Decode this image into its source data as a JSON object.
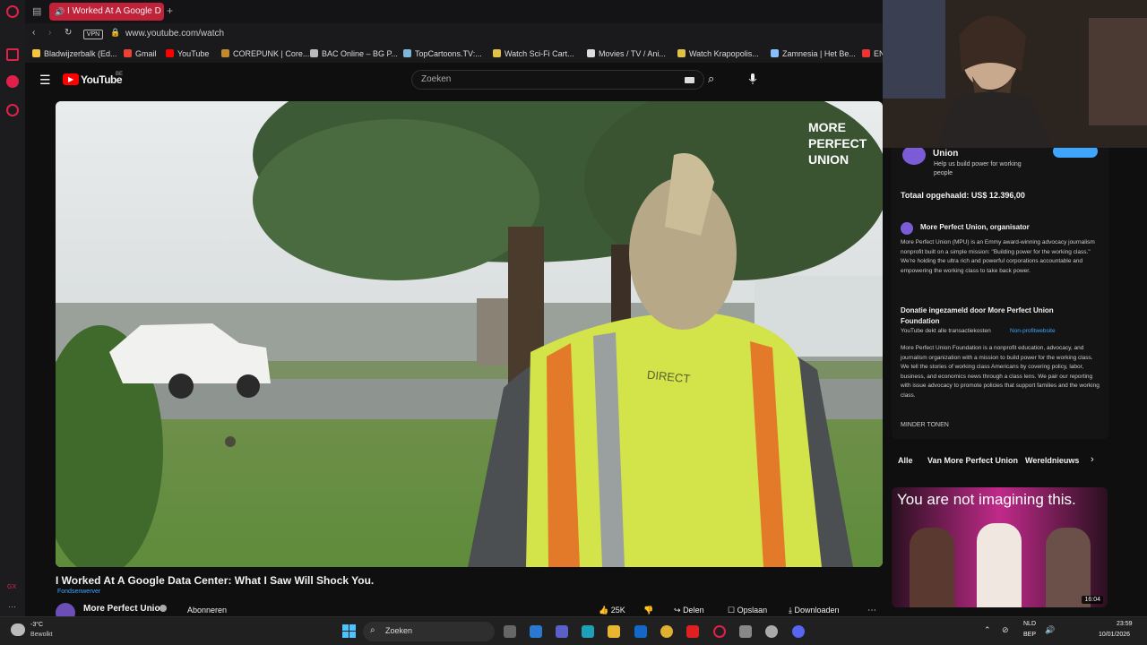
{
  "browser": {
    "active_tab_title": "I Worked At A Google D",
    "url": "www.youtube.com/watch",
    "vpn_label": "VPN",
    "bookmarks": [
      {
        "label": "Bladwijzerbalk (Ed...",
        "color": "#f5c542"
      },
      {
        "label": "Gmail",
        "color": "#ea4335"
      },
      {
        "label": "YouTube",
        "color": "#ff0000"
      },
      {
        "label": "COREPUNK | Core...",
        "color": "#c28a2e"
      },
      {
        "label": "BAC Online – BG P...",
        "color": "#bbbbbb"
      },
      {
        "label": "TopCartoons.TV:...",
        "color": "#7fb7d9"
      },
      {
        "label": "Watch Sci-Fi Cart...",
        "color": "#e0c14a"
      },
      {
        "label": "Movies / TV / Ani...",
        "color": "#dddddd"
      },
      {
        "label": "Watch Krapopolis...",
        "color": "#e0c14a"
      },
      {
        "label": "Zamnesia | Het Be...",
        "color": "#88c0ff"
      },
      {
        "label": "EN",
        "color": "#e33"
      }
    ]
  },
  "youtube": {
    "logo_text": "YouTube",
    "region": "BE",
    "search_placeholder": "Zoeken",
    "video_watermark": [
      "MORE",
      "PERFECT",
      "UNION"
    ],
    "vest_text": "DIRECT",
    "video_title": "I Worked At A Google Data Center: What I Saw Will Shock You.",
    "fundraiser_label": "Fondsenwerver",
    "channel_name": "More Perfect Union",
    "subscribe_label": "Abonneren",
    "likes": "25K",
    "share_label": "Delen",
    "save_label": "Opslaan",
    "download_label": "Downloaden"
  },
  "panel": {
    "org_title": "Union",
    "org_sub": "Help us build power for working people",
    "total": "Totaal opgehaald: US$ 12.396,00",
    "organizer": "More Perfect Union, organisator",
    "organizer_desc": "More Perfect Union (MPU) is an Emmy award-winning advocacy journalism nonprofit built on a simple mission: \"Building power for the working class.\" We're holding the ultra rich and powerful corporations accountable and empowering the working class to take back power.",
    "donation_title": "Donatie ingezameld door More Perfect Union Foundation",
    "fees": "YouTube dekt alle transactiekosten",
    "nonprofit_link": "Non-profitwebsite",
    "foundation_desc": "More Perfect Union Foundation is a nonprofit education, advocacy, and journalism organization with a mission to build power for the working class. We tell the stories of working class Americans by covering policy, labor, business, and economics news through a class lens. We pair our reporting with issue advocacy to promote policies that support families and the working class.",
    "show_less": "MINDER TONEN",
    "chips": [
      "Alle",
      "Van More Perfect Union",
      "Wereldnieuws"
    ],
    "thumb_text": "You are not imagining this.",
    "thumb_duration": "16:04"
  },
  "taskbar": {
    "weather_temp": "-3°C",
    "weather_desc": "Bewolkt",
    "search_placeholder": "Zoeken",
    "lang_top": "NLD",
    "lang_bottom": "BEP",
    "time": "23:59",
    "date": "10/01/2026"
  }
}
